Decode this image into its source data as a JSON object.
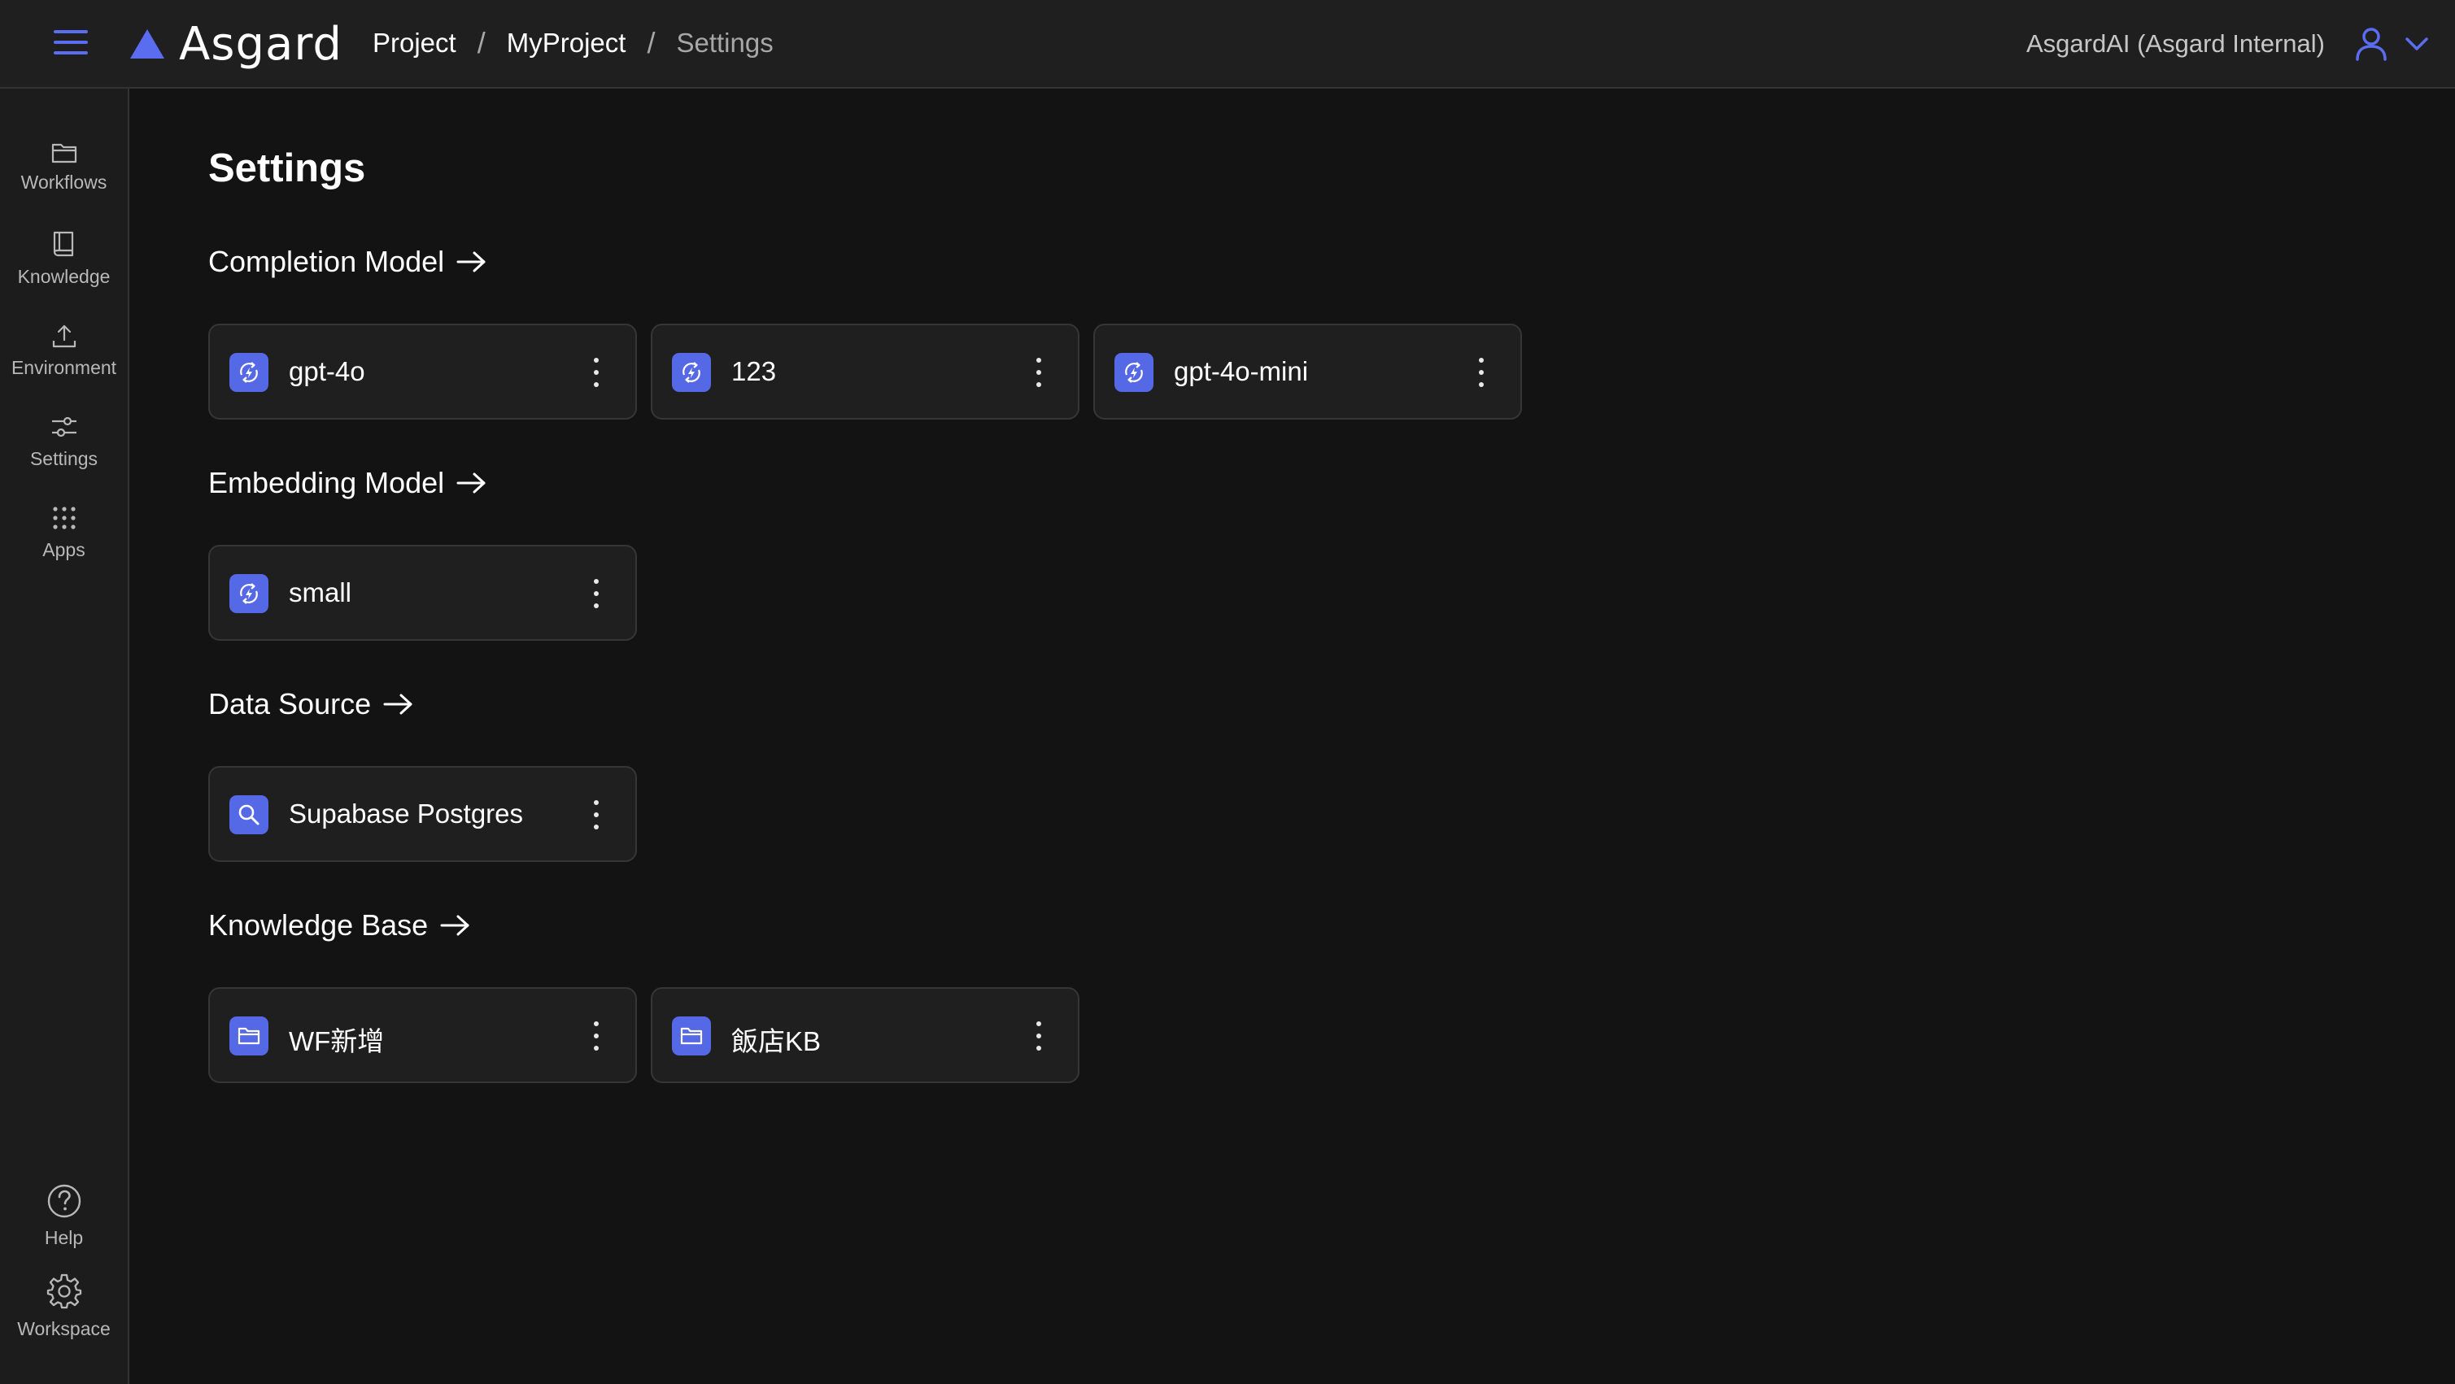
{
  "app": {
    "name": "Asgard"
  },
  "breadcrumb": {
    "items": [
      "Project",
      "MyProject",
      "Settings"
    ],
    "separator": "/"
  },
  "account": {
    "name": "AsgardAI (Asgard Internal)"
  },
  "sidebar": {
    "items": [
      {
        "label": "Workflows",
        "icon": "folder-icon"
      },
      {
        "label": "Knowledge",
        "icon": "book-icon"
      },
      {
        "label": "Environment",
        "icon": "upload-icon"
      },
      {
        "label": "Settings",
        "icon": "sliders-icon"
      },
      {
        "label": "Apps",
        "icon": "grid-dots-icon"
      }
    ],
    "bottom": [
      {
        "label": "Help",
        "icon": "help-circle-icon"
      },
      {
        "label": "Workspace",
        "icon": "gear-icon"
      }
    ]
  },
  "page": {
    "title": "Settings"
  },
  "sections": {
    "completion": {
      "title": "Completion Model",
      "cards": [
        {
          "label": "gpt-4o",
          "icon": "model-sync-icon"
        },
        {
          "label": "123",
          "icon": "model-sync-icon"
        },
        {
          "label": "gpt-4o-mini",
          "icon": "model-sync-icon"
        }
      ]
    },
    "embedding": {
      "title": "Embedding Model",
      "cards": [
        {
          "label": "small",
          "icon": "model-sync-icon"
        }
      ]
    },
    "datasource": {
      "title": "Data Source",
      "cards": [
        {
          "label": "Supabase Postgres",
          "icon": "search-icon"
        }
      ]
    },
    "knowledge": {
      "title": "Knowledge Base",
      "cards": [
        {
          "label": "WF新增",
          "icon": "folder-icon"
        },
        {
          "label": "飯店KB",
          "icon": "folder-icon"
        }
      ]
    }
  },
  "colors": {
    "accent": "#5568e6",
    "background": "#131313",
    "topbar": "#1f1f1f",
    "card": "#1f1f1f"
  }
}
